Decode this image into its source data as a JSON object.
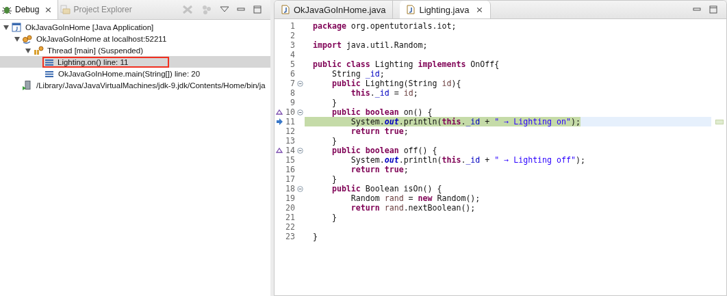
{
  "debug_view": {
    "tabs": [
      {
        "label": "Debug",
        "selected": true,
        "close": "⨯"
      },
      {
        "label": "Project Explorer",
        "selected": false
      }
    ],
    "tree": [
      {
        "label": "OkJavaGoInHome [Java Application]",
        "kind": "application",
        "expanded": true,
        "selected": false,
        "children": [
          {
            "label": "OkJavaGoInHome at localhost:52211",
            "kind": "vm",
            "expanded": true,
            "selected": false,
            "children": [
              {
                "label": "Thread [main] (Suspended)",
                "kind": "thread",
                "expanded": true,
                "selected": false,
                "children": [
                  {
                    "label": "Lighting.on() line: 11",
                    "kind": "frame",
                    "selected": true,
                    "highlighted": true
                  },
                  {
                    "label": "OkJavaGoInHome.main(String[]) line: 20",
                    "kind": "frame",
                    "selected": false,
                    "highlighted": false
                  }
                ]
              }
            ]
          },
          {
            "label": "/Library/Java/JavaVirtualMachines/jdk-9.jdk/Contents/Home/bin/ja",
            "kind": "process",
            "selected": false
          }
        ]
      }
    ]
  },
  "editor": {
    "tabs": [
      {
        "label": "OkJavaGoInHome.java",
        "selected": false
      },
      {
        "label": "Lighting.java",
        "selected": true,
        "close": "⨯"
      }
    ],
    "lines": [
      {
        "num": "1",
        "tokens": [
          {
            "kind": "kw",
            "text": "package "
          },
          {
            "kind": "plain",
            "text": "org.opentutorials.iot;"
          }
        ]
      },
      {
        "num": "2"
      },
      {
        "num": "3",
        "tokens": [
          {
            "kind": "kw",
            "text": "import "
          },
          {
            "kind": "plain",
            "text": "java.util.Random;"
          }
        ]
      },
      {
        "num": "4"
      },
      {
        "num": "5",
        "tokens": [
          {
            "kind": "kw",
            "text": "public class "
          },
          {
            "kind": "plain",
            "text": "Lighting "
          },
          {
            "kind": "kw",
            "text": "implements "
          },
          {
            "kind": "plain",
            "text": "OnOff{"
          }
        ]
      },
      {
        "num": "6",
        "tokens": [
          {
            "kind": "plain",
            "text": "    String "
          },
          {
            "kind": "field",
            "text": "_id"
          },
          {
            "kind": "plain",
            "text": ";"
          }
        ]
      },
      {
        "num": "7",
        "fold": true,
        "tokens": [
          {
            "kind": "kw",
            "text": "    public "
          },
          {
            "kind": "plain",
            "text": "Lighting(String "
          },
          {
            "kind": "local",
            "text": "id"
          },
          {
            "kind": "plain",
            "text": "){"
          }
        ]
      },
      {
        "num": "8",
        "tokens": [
          {
            "kind": "kw",
            "text": "        this"
          },
          {
            "kind": "plain",
            "text": "."
          },
          {
            "kind": "field",
            "text": "_id"
          },
          {
            "kind": "plain",
            "text": " = "
          },
          {
            "kind": "local",
            "text": "id"
          },
          {
            "kind": "plain",
            "text": ";"
          }
        ]
      },
      {
        "num": "9",
        "tokens": [
          {
            "kind": "plain",
            "text": "    }"
          }
        ]
      },
      {
        "num": "10",
        "fold": true,
        "override": true,
        "tokens": [
          {
            "kind": "kw",
            "text": "    public boolean "
          },
          {
            "kind": "plain",
            "text": "on() {"
          }
        ]
      },
      {
        "num": "11",
        "current": true,
        "tokens": [
          {
            "kind": "plain",
            "text": "        System."
          },
          {
            "kind": "static",
            "text": "out"
          },
          {
            "kind": "plain",
            "text": ".println("
          },
          {
            "kind": "kw",
            "text": "this"
          },
          {
            "kind": "plain",
            "text": "."
          },
          {
            "kind": "field",
            "text": "_id"
          },
          {
            "kind": "plain",
            "text": " + "
          },
          {
            "kind": "string",
            "text": "\" → Lighting on\""
          },
          {
            "kind": "plain",
            "text": ");"
          }
        ]
      },
      {
        "num": "12",
        "tokens": [
          {
            "kind": "kw",
            "text": "        return true"
          },
          {
            "kind": "plain",
            "text": ";"
          }
        ]
      },
      {
        "num": "13",
        "tokens": [
          {
            "kind": "plain",
            "text": "    }"
          }
        ]
      },
      {
        "num": "14",
        "fold": true,
        "override": true,
        "tokens": [
          {
            "kind": "kw",
            "text": "    public boolean "
          },
          {
            "kind": "plain",
            "text": "off() {"
          }
        ]
      },
      {
        "num": "15",
        "tokens": [
          {
            "kind": "plain",
            "text": "        System."
          },
          {
            "kind": "static",
            "text": "out"
          },
          {
            "kind": "plain",
            "text": ".println("
          },
          {
            "kind": "kw",
            "text": "this"
          },
          {
            "kind": "plain",
            "text": "."
          },
          {
            "kind": "field",
            "text": "_id"
          },
          {
            "kind": "plain",
            "text": " + "
          },
          {
            "kind": "string",
            "text": "\" → Lighting off\""
          },
          {
            "kind": "plain",
            "text": ");"
          }
        ]
      },
      {
        "num": "16",
        "tokens": [
          {
            "kind": "kw",
            "text": "        return true"
          },
          {
            "kind": "plain",
            "text": ";"
          }
        ]
      },
      {
        "num": "17",
        "tokens": [
          {
            "kind": "plain",
            "text": "    }"
          }
        ]
      },
      {
        "num": "18",
        "fold": true,
        "tokens": [
          {
            "kind": "kw",
            "text": "    public "
          },
          {
            "kind": "plain",
            "text": "Boolean isOn() {"
          }
        ]
      },
      {
        "num": "19",
        "tokens": [
          {
            "kind": "plain",
            "text": "        Random "
          },
          {
            "kind": "local",
            "text": "rand"
          },
          {
            "kind": "plain",
            "text": " = "
          },
          {
            "kind": "kw",
            "text": "new "
          },
          {
            "kind": "plain",
            "text": "Random();"
          }
        ]
      },
      {
        "num": "20",
        "tokens": [
          {
            "kind": "kw",
            "text": "        return "
          },
          {
            "kind": "local",
            "text": "rand"
          },
          {
            "kind": "plain",
            "text": ".nextBoolean();"
          }
        ]
      },
      {
        "num": "21",
        "tokens": [
          {
            "kind": "plain",
            "text": "    }"
          }
        ]
      },
      {
        "num": "22"
      },
      {
        "num": "23",
        "tokens": [
          {
            "kind": "plain",
            "text": "}"
          }
        ]
      }
    ]
  }
}
